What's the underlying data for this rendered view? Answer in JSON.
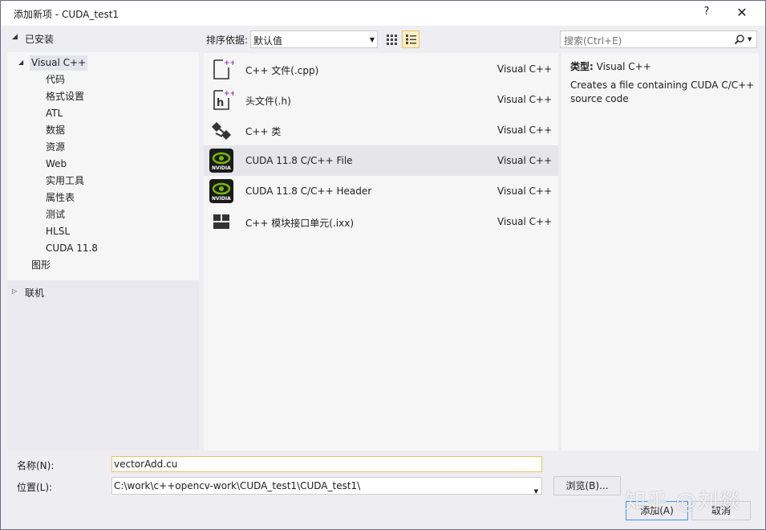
{
  "window": {
    "title": "添加新项 - CUDA_test1",
    "help": "?",
    "close": "✕"
  },
  "left": {
    "installed": "已安装",
    "tree": [
      {
        "label": "Visual C++",
        "level": 0,
        "expanded": true
      },
      {
        "label": "代码",
        "level": 1
      },
      {
        "label": "格式设置",
        "level": 1
      },
      {
        "label": "ATL",
        "level": 1
      },
      {
        "label": "数据",
        "level": 1
      },
      {
        "label": "资源",
        "level": 1
      },
      {
        "label": "Web",
        "level": 1
      },
      {
        "label": "实用工具",
        "level": 1
      },
      {
        "label": "属性表",
        "level": 1
      },
      {
        "label": "测试",
        "level": 1
      },
      {
        "label": "HLSL",
        "level": 1
      },
      {
        "label": "CUDA 11.8",
        "level": 1
      },
      {
        "label": "图形",
        "level": 0
      }
    ],
    "online": "联机"
  },
  "toolbar": {
    "sort_label": "排序依据:",
    "sort_value": "默认值",
    "search_placeholder": "搜索(Ctrl+E)"
  },
  "templates": [
    {
      "name": "C++ 文件(.cpp)",
      "category": "Visual C++",
      "icon": "cpp-file-icon"
    },
    {
      "name": "头文件(.h)",
      "category": "Visual C++",
      "icon": "header-file-icon"
    },
    {
      "name": "C++ 类",
      "category": "Visual C++",
      "icon": "class-icon"
    },
    {
      "name": "CUDA 11.8 C/C++ File",
      "category": "Visual C++",
      "icon": "nvidia-icon",
      "selected": true
    },
    {
      "name": "CUDA 11.8 C/C++ Header",
      "category": "Visual C++",
      "icon": "nvidia-icon"
    },
    {
      "name": "C++ 模块接口单元(.ixx)",
      "category": "Visual C++",
      "icon": "module-icon"
    }
  ],
  "details": {
    "type_label": "类型:",
    "type_value": "Visual C++",
    "description": "Creates a file containing CUDA C/C++ source code"
  },
  "form": {
    "name_label": "名称(N):",
    "name_value": "vectorAdd.cu",
    "location_label": "位置(L):",
    "location_value": "C:\\work\\c++opencv-work\\CUDA_test1\\CUDA_test1\\",
    "browse_label": "浏览(B)...",
    "add_label": "添加(A)",
    "cancel_label": "取消"
  },
  "watermark": "知乎 @刘燚",
  "colors": {
    "accent": "#e5c365",
    "selection": "#e6e6ea",
    "nvidia_green": "#76b900"
  }
}
